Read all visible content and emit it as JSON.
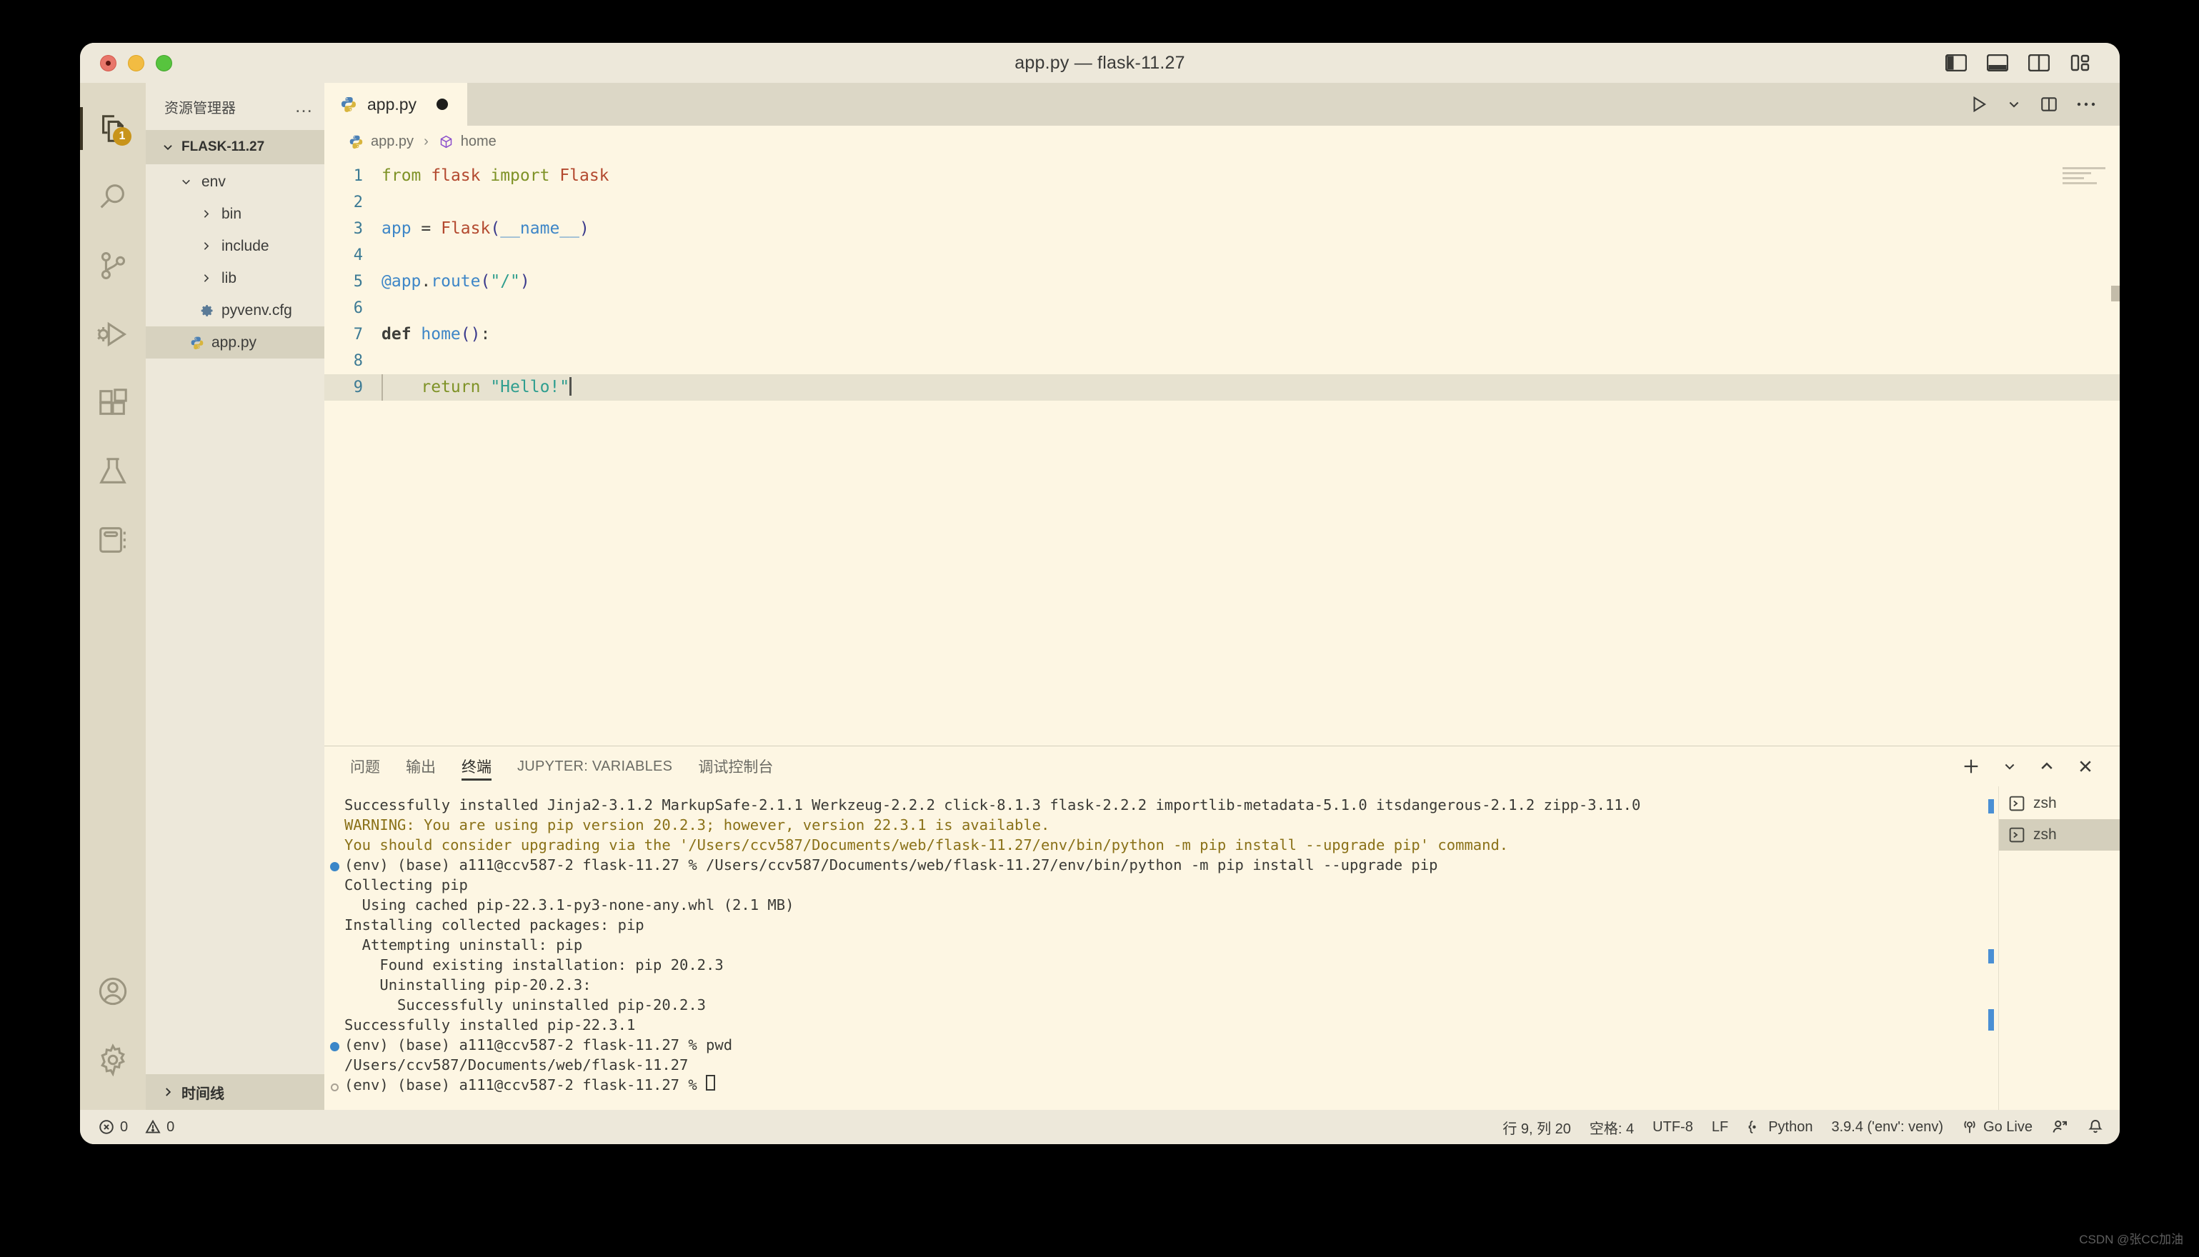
{
  "window": {
    "title": "app.py — flask-11.27",
    "traffic_lights": [
      "close",
      "minimize",
      "maximize"
    ],
    "layout_buttons": [
      "toggle-primary-sidebar",
      "toggle-panel",
      "toggle-secondary-sidebar",
      "customize-layout"
    ]
  },
  "activitybar": {
    "items": [
      {
        "name": "explorer",
        "badge": "1"
      },
      {
        "name": "search",
        "badge": ""
      },
      {
        "name": "source-control",
        "badge": ""
      },
      {
        "name": "run-and-debug",
        "badge": ""
      },
      {
        "name": "extensions",
        "badge": ""
      },
      {
        "name": "testing",
        "badge": ""
      },
      {
        "name": "notebook",
        "badge": ""
      }
    ],
    "bottom": [
      {
        "name": "accounts"
      },
      {
        "name": "manage-settings"
      }
    ]
  },
  "sidebar": {
    "title": "资源管理器",
    "more_actions": "…",
    "root_folder": "FLASK-11.27",
    "timeline": "时间线",
    "tree": [
      {
        "label": "env",
        "type": "folder",
        "expanded": true,
        "depth": 1
      },
      {
        "label": "bin",
        "type": "folder",
        "expanded": false,
        "depth": 2
      },
      {
        "label": "include",
        "type": "folder",
        "expanded": false,
        "depth": 2
      },
      {
        "label": "lib",
        "type": "folder",
        "expanded": false,
        "depth": 2
      },
      {
        "label": "pyvenv.cfg",
        "type": "config",
        "expanded": false,
        "depth": 2
      },
      {
        "label": "app.py",
        "type": "python",
        "expanded": false,
        "depth": 1,
        "selected": true
      }
    ]
  },
  "editor": {
    "tabs": [
      {
        "label": "app.py",
        "icon": "python-icon",
        "dirty": true,
        "active": true
      }
    ],
    "actions": [
      "run-python-file",
      "run-dropdown",
      "split-editor",
      "more-actions"
    ],
    "breadcrumb": [
      {
        "label": "app.py",
        "icon": "python-icon"
      },
      {
        "label": "home",
        "icon": "symbol-method-icon"
      }
    ],
    "filename": "app.py",
    "lines": [
      {
        "n": "1",
        "tokens": [
          {
            "t": "from ",
            "c": "kw"
          },
          {
            "t": "flask ",
            "c": "cls"
          },
          {
            "t": "import ",
            "c": "kw"
          },
          {
            "t": "Flask",
            "c": "cls"
          }
        ]
      },
      {
        "n": "2",
        "tokens": []
      },
      {
        "n": "3",
        "tokens": [
          {
            "t": "app ",
            "c": "var"
          },
          {
            "t": "= ",
            "c": "plain"
          },
          {
            "t": "Flask",
            "c": "cls"
          },
          {
            "t": "(",
            "c": "punc"
          },
          {
            "t": "__name__",
            "c": "var"
          },
          {
            "t": ")",
            "c": "punc"
          }
        ]
      },
      {
        "n": "4",
        "tokens": []
      },
      {
        "n": "5",
        "tokens": [
          {
            "t": "@app",
            "c": "dec"
          },
          {
            "t": ".",
            "c": "plain"
          },
          {
            "t": "route",
            "c": "dec"
          },
          {
            "t": "(",
            "c": "punc"
          },
          {
            "t": "\"/\"",
            "c": "str"
          },
          {
            "t": ")",
            "c": "punc"
          }
        ]
      },
      {
        "n": "6",
        "tokens": []
      },
      {
        "n": "7",
        "tokens": [
          {
            "t": "def ",
            "c": "kw-b"
          },
          {
            "t": "home",
            "c": "fn"
          },
          {
            "t": "()",
            "c": "punc"
          },
          {
            "t": ":",
            "c": "plain"
          }
        ]
      },
      {
        "n": "8",
        "tokens": [],
        "guide": true
      },
      {
        "n": "9",
        "tokens": [
          {
            "t": "    ",
            "c": "plain"
          },
          {
            "t": "return ",
            "c": "kw"
          },
          {
            "t": "\"Hello!\"",
            "c": "str"
          }
        ],
        "guide": true,
        "highlight": true,
        "caret": true
      }
    ]
  },
  "panel": {
    "tabs": [
      {
        "label": "问题",
        "active": false
      },
      {
        "label": "输出",
        "active": false
      },
      {
        "label": "终端",
        "active": true
      },
      {
        "label": "JUPYTER: VARIABLES",
        "active": false,
        "upper": true
      },
      {
        "label": "调试控制台",
        "active": false
      }
    ],
    "actions": [
      "new-terminal",
      "terminal-dropdown",
      "maximize-panel",
      "close-panel"
    ],
    "terminal_lines": [
      {
        "mark": "",
        "text": "Successfully installed Jinja2-3.1.2 MarkupSafe-2.1.1 Werkzeug-2.2.2 click-8.1.3 flask-2.2.2 importlib-metadata-5.1.0 itsdangerous-2.1.2 zipp-3.11.0",
        "style": "normal"
      },
      {
        "mark": "",
        "text": "WARNING: You are using pip version 20.2.3; however, version 22.3.1 is available.",
        "style": "warn"
      },
      {
        "mark": "",
        "text": "You should consider upgrading via the '/Users/ccv587/Documents/web/flask-11.27/env/bin/python -m pip install --upgrade pip' command.",
        "style": "warn"
      },
      {
        "mark": "filled",
        "text": "(env) (base) a111@ccv587-2 flask-11.27 % /Users/ccv587/Documents/web/flask-11.27/env/bin/python -m pip install --upgrade pip",
        "style": "normal"
      },
      {
        "mark": "",
        "text": "Collecting pip",
        "style": "normal"
      },
      {
        "mark": "",
        "text": "  Using cached pip-22.3.1-py3-none-any.whl (2.1 MB)",
        "style": "normal"
      },
      {
        "mark": "",
        "text": "Installing collected packages: pip",
        "style": "normal"
      },
      {
        "mark": "",
        "text": "  Attempting uninstall: pip",
        "style": "normal"
      },
      {
        "mark": "",
        "text": "    Found existing installation: pip 20.2.3",
        "style": "normal"
      },
      {
        "mark": "",
        "text": "    Uninstalling pip-20.2.3:",
        "style": "normal"
      },
      {
        "mark": "",
        "text": "      Successfully uninstalled pip-20.2.3",
        "style": "normal"
      },
      {
        "mark": "",
        "text": "Successfully installed pip-22.3.1",
        "style": "normal"
      },
      {
        "mark": "filled",
        "text": "(env) (base) a111@ccv587-2 flask-11.27 % pwd",
        "style": "normal"
      },
      {
        "mark": "",
        "text": "/Users/ccv587/Documents/web/flask-11.27",
        "style": "normal"
      },
      {
        "mark": "outline",
        "text": "(env) (base) a111@ccv587-2 flask-11.27 % ",
        "style": "normal",
        "cursor": true
      }
    ],
    "terminal_tabs": [
      {
        "label": "zsh",
        "selected": false
      },
      {
        "label": "zsh",
        "selected": true
      }
    ]
  },
  "statusbar": {
    "errors": "0",
    "warnings": "0",
    "cursor_position": "行 9, 列 20",
    "indentation": "空格: 4",
    "encoding": "UTF-8",
    "eol": "LF",
    "language": "Python",
    "interpreter": "3.9.4 ('env': venv)",
    "go_live": "Go Live",
    "right_icons": [
      "remote-feedback",
      "notifications"
    ]
  },
  "watermark": "CSDN @张CC加油"
}
